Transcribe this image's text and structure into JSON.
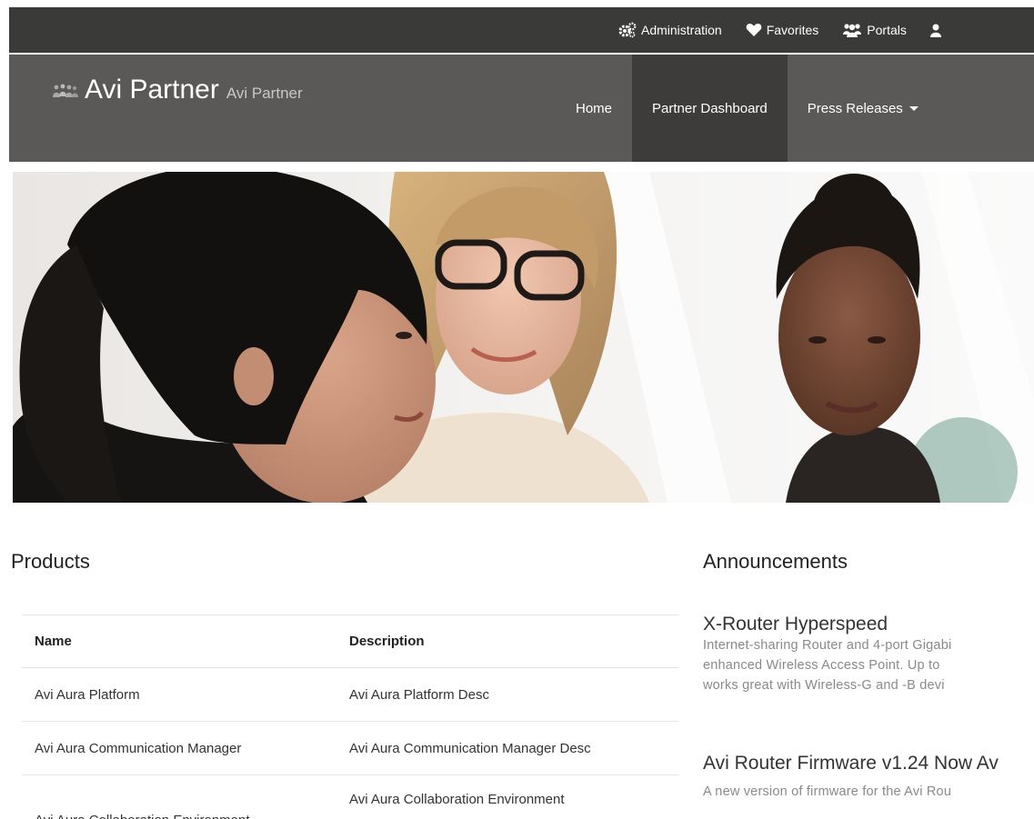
{
  "topbar": {
    "links": [
      {
        "label": "Administration",
        "icon": "gears-icon"
      },
      {
        "label": "Favorites",
        "icon": "heart-icon"
      },
      {
        "label": "Portals",
        "icon": "users-icon"
      }
    ]
  },
  "brand": {
    "title": "Avi Partner",
    "subtitle": "Avi Partner",
    "icon": "people-icon"
  },
  "nav": {
    "items": [
      {
        "label": "Home",
        "active": false
      },
      {
        "label": "Partner Dashboard",
        "active": true
      },
      {
        "label": "Press Releases",
        "active": false,
        "dropdown": true
      }
    ]
  },
  "hero": {
    "image": "three-women-office-photo"
  },
  "products": {
    "title": "Products",
    "headers": [
      "Name",
      "Description"
    ],
    "rows": [
      [
        "Avi Aura Platform",
        "Avi Aura Platform Desc"
      ],
      [
        "Avi Aura Communication Manager",
        "Avi Aura Communication Manager Desc"
      ],
      [
        "Avi Aura Collaboration Environment",
        "Avi Aura Collaboration Environment"
      ]
    ]
  },
  "announcements": {
    "title": "Announcements",
    "items": [
      {
        "heading": "X-Router Hyperspeed",
        "lines": [
          "Internet-sharing Router and 4-port Gigabi",
          "enhanced Wireless Access Point. Up to",
          "works great with Wireless-G and -B devi"
        ]
      },
      {
        "heading": "Avi Router Firmware v1.24 Now Av",
        "lines": [
          "A new version of firmware for the Avi Rou"
        ]
      }
    ]
  },
  "colors": {
    "topbar": "#3a3a38",
    "navbar": "#5a5957",
    "nav_active": "#3d3c3a"
  }
}
